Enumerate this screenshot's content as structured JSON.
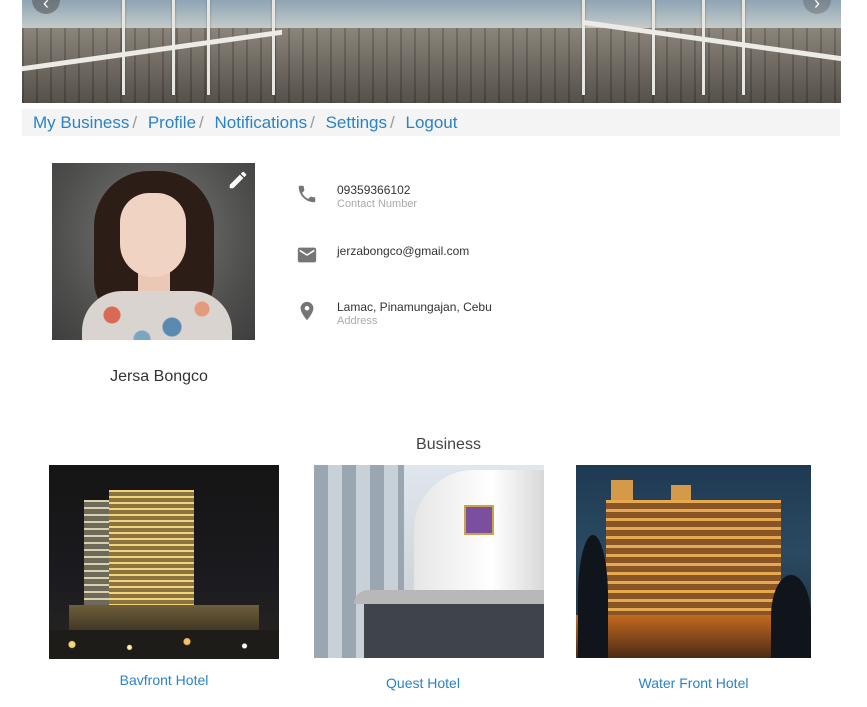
{
  "nav": {
    "items": [
      {
        "label": "My Business"
      },
      {
        "label": "Profile"
      },
      {
        "label": "Notifications"
      },
      {
        "label": "Settings"
      },
      {
        "label": "Logout"
      }
    ],
    "separator": "/"
  },
  "profile": {
    "name": "Jersa Bongco",
    "phone": {
      "value": "09359366102",
      "label": "Contact Number",
      "icon": "phone-icon"
    },
    "email": {
      "value": "jerzabongco@gmail.com",
      "icon": "mail-icon"
    },
    "address": {
      "value": "Lamac, Pinamungajan, Cebu",
      "label": "Address",
      "icon": "location-pin-icon"
    },
    "edit_icon": "pencil-icon"
  },
  "business": {
    "title": "Business",
    "items": [
      {
        "name": "Bavfront Hotel"
      },
      {
        "name": "Quest Hotel"
      },
      {
        "name": "Water Front Hotel"
      }
    ]
  },
  "colors": {
    "link": "#2a82c9",
    "nav_bg": "#f4f4f4",
    "icon": "#757575"
  }
}
